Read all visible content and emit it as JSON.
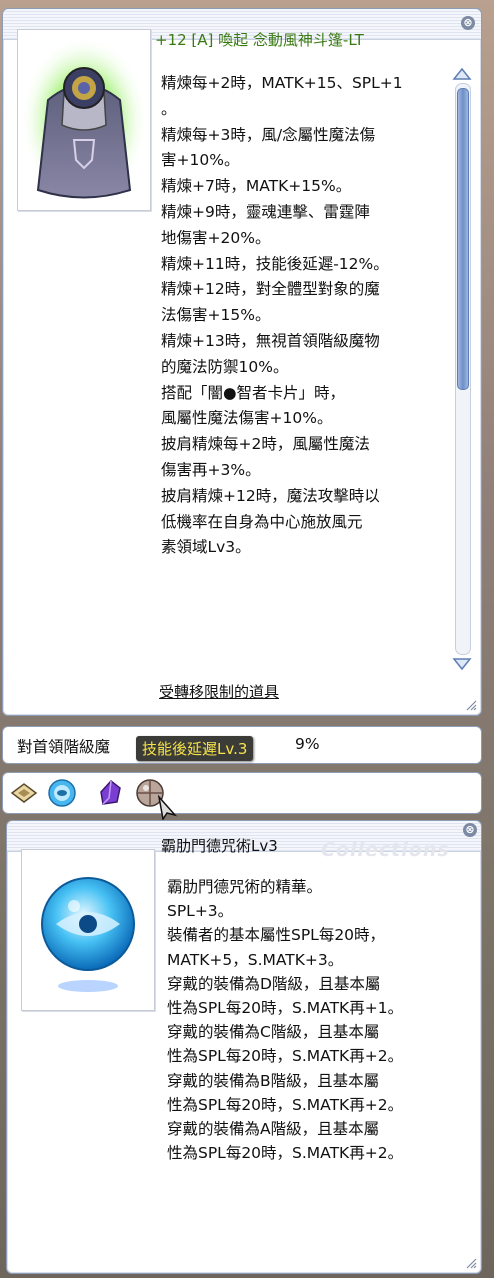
{
  "item_window": {
    "title": "+12 [A] 喚起 念動風神斗篷-LT",
    "close_glyph": "⊗",
    "description_lines": [
      "精煉每+2時，MATK+15、SPL+1",
      "。",
      "精煉每+3時，風/念屬性魔法傷",
      "害+10%。",
      "精煉+7時，MATK+15%。",
      "精煉+9時，靈魂連擊、雷霆陣",
      "地傷害+20%。",
      "精煉+11時，技能後延遲-12%。",
      "精煉+12時，對全體型對象的魔",
      "法傷害+15%。",
      "精煉+13時，無視首領階級魔物",
      "的魔法防禦10%。",
      "搭配「闇●智者卡片」時，",
      "風屬性魔法傷害+10%。",
      "披肩精煉每+2時，風屬性魔法",
      "傷害再+3%。",
      "披肩精煉+12時，魔法攻擊時以",
      "低機率在自身為中心施放風元",
      "素領域Lv3。"
    ],
    "link_text": "受轉移限制的道具"
  },
  "option_bar": {
    "text_before": "對首領階級魔",
    "text_after": "9%"
  },
  "tooltip": {
    "text": "技能後延遲Lv.3"
  },
  "enchant_icons": [
    "card-slot-icon",
    "blue-orb-icon",
    "purple-crystal-icon",
    "silver-sphere-icon"
  ],
  "card_window": {
    "title": "霸肋門德咒術Lv3",
    "watermark": "Collections",
    "close_glyph": "⊗",
    "description_lines": [
      "霸肋門德咒術的精華。",
      "SPL+3。",
      "裝備者的基本屬性SPL每20時，",
      "MATK+5，S.MATK+3。",
      "穿戴的裝備為D階級，且基本屬",
      "性為SPL每20時，S.MATK再+1。",
      "穿戴的裝備為C階級，且基本屬",
      "性為SPL每20時，S.MATK再+2。",
      "穿戴的裝備為B階級，且基本屬",
      "性為SPL每20時，S.MATK再+2。",
      "穿戴的裝備為A階級，且基本屬",
      "性為SPL每20時，S.MATK再+2。"
    ]
  },
  "colors": {
    "title_green": "#3a7a12",
    "tooltip_text": "#f6e34a",
    "window_border": "#8e9db7"
  }
}
